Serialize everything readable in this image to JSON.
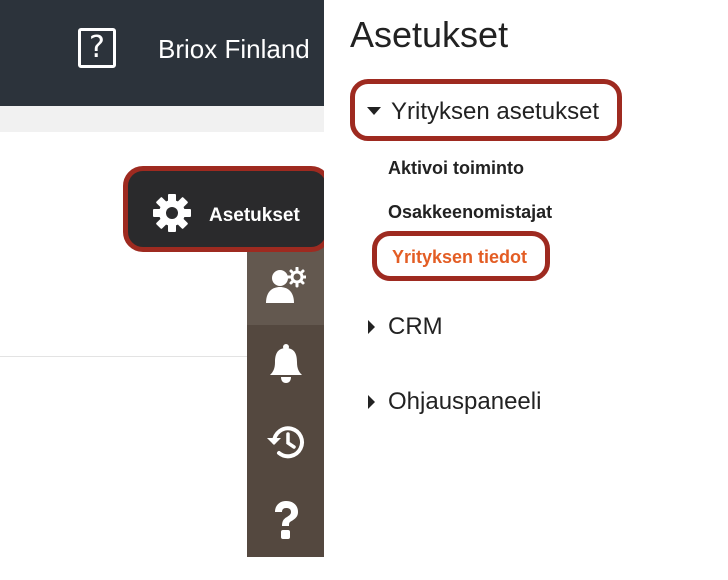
{
  "header": {
    "logo_glyph": "?",
    "company_name": "Briox Finland"
  },
  "settings_button": {
    "label": "Asetukset",
    "icon": "gear-icon"
  },
  "side_icons": [
    {
      "icon": "user-settings-icon"
    },
    {
      "icon": "bell-icon"
    },
    {
      "icon": "history-icon"
    },
    {
      "icon": "help-icon"
    }
  ],
  "panel": {
    "title": "Asetukset",
    "sections": [
      {
        "label": "Yrityksen asetukset",
        "expanded": true,
        "items": [
          {
            "label": "Aktivoi toiminto"
          },
          {
            "label": "Osakkeenomistajat"
          },
          {
            "label": "Yrityksen tiedot",
            "active": true
          }
        ]
      },
      {
        "label": "CRM",
        "expanded": false
      },
      {
        "label": "Ohjauspaneeli",
        "expanded": false
      }
    ]
  },
  "colors": {
    "accent": "#e35d24",
    "highlight_border": "#9e2a20",
    "header_bg": "#2c333b",
    "icon_column_bg": "#54483f"
  }
}
